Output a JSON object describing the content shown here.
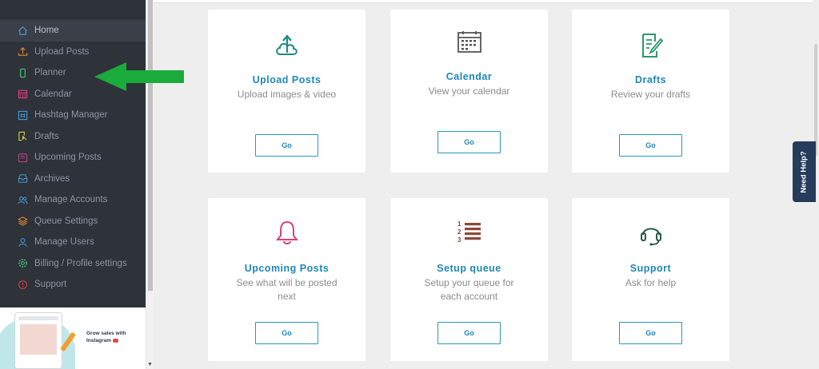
{
  "sidebar": {
    "items": [
      {
        "label": "Home",
        "icon": "home-icon",
        "color": "#4a9bd8",
        "active": true
      },
      {
        "label": "Upload Posts",
        "icon": "upload-icon",
        "color": "#e08a3a"
      },
      {
        "label": "Planner",
        "icon": "phone-icon",
        "color": "#4cc47a"
      },
      {
        "label": "Calendar",
        "icon": "calendar-icon",
        "color": "#d8437a"
      },
      {
        "label": "Hashtag Manager",
        "icon": "hashtag-icon",
        "color": "#4a9bd8"
      },
      {
        "label": "Drafts",
        "icon": "drafts-icon",
        "color": "#c5d64a"
      },
      {
        "label": "Upcoming Posts",
        "icon": "clock-icon",
        "color": "#b4447a"
      },
      {
        "label": "Archives",
        "icon": "inbox-icon",
        "color": "#4a9bd8"
      },
      {
        "label": "Manage Accounts",
        "icon": "users-icon",
        "color": "#4a9bd8"
      },
      {
        "label": "Queue Settings",
        "icon": "layers-icon",
        "color": "#e08a3a"
      },
      {
        "label": "Manage Users",
        "icon": "user-icon",
        "color": "#4a9bd8"
      },
      {
        "label": "Billing / Profile settings",
        "icon": "gear-icon",
        "color": "#4cc47a"
      },
      {
        "label": "Support",
        "icon": "lifebuoy-icon",
        "color": "#d8434a"
      }
    ]
  },
  "promo": {
    "text": "Grow sales with Instagram"
  },
  "cards": [
    {
      "title": "Upload Posts",
      "subtitle": "Upload images & video",
      "button": "Go",
      "icon": "cloud-upload-icon",
      "icon_color": "#1e8a8a"
    },
    {
      "title": "Calendar",
      "subtitle": "View your calendar",
      "button": "Go",
      "icon": "calendar-icon",
      "icon_color": "#555555"
    },
    {
      "title": "Drafts",
      "subtitle": "Review your drafts",
      "button": "Go",
      "icon": "drafts-icon",
      "icon_color": "#2a9a6a"
    },
    {
      "title": "Upcoming Posts",
      "subtitle": "See what will be posted next",
      "button": "Go",
      "icon": "bell-icon",
      "icon_color": "#d8437a"
    },
    {
      "title": "Setup queue",
      "subtitle": "Setup your queue for each account",
      "button": "Go",
      "icon": "numbered-list-icon",
      "icon_color": "#8a4a3a"
    },
    {
      "title": "Support",
      "subtitle": "Ask for help",
      "button": "Go",
      "icon": "headset-icon",
      "icon_color": "#2a5a4a"
    }
  ],
  "need_help": "Need Help?",
  "annotation": {
    "arrow_color": "#1aab3a",
    "points_to": "Planner"
  }
}
